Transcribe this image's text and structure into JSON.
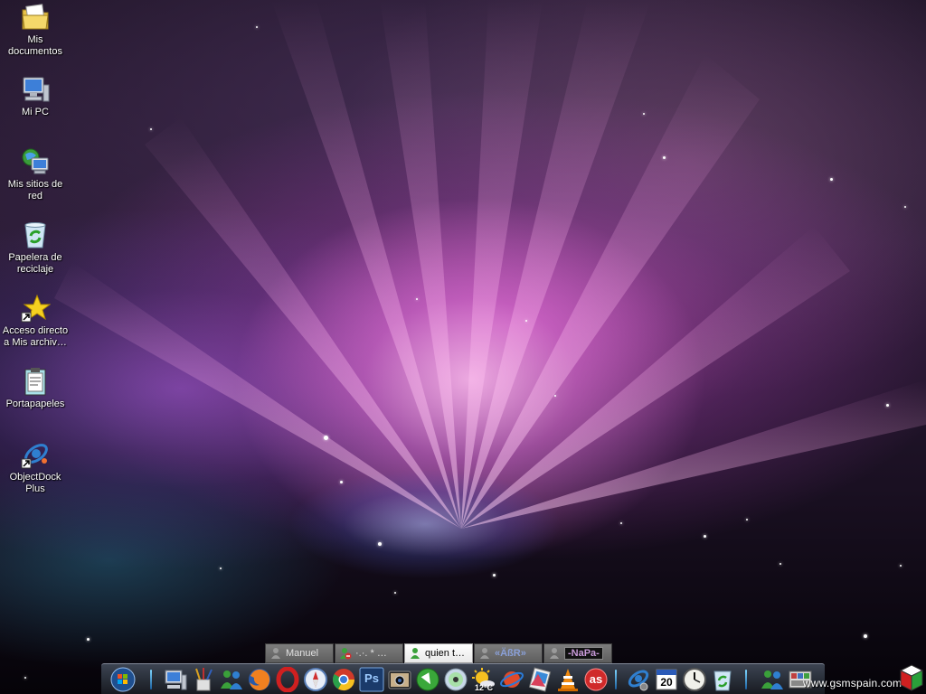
{
  "desktop": {
    "icons": [
      {
        "label": "Mis documentos",
        "icon": "folder-documents-icon"
      },
      {
        "label": "Mi PC",
        "icon": "computer-icon"
      },
      {
        "label": "Mis sitios de red",
        "icon": "network-places-icon"
      },
      {
        "label": "Papelera de reciclaje",
        "icon": "recycle-bin-icon"
      },
      {
        "label": "Acceso directo a Mis archiv…",
        "icon": "star-shortcut-icon"
      },
      {
        "label": "Portapapeles",
        "icon": "clipboard-icon"
      },
      {
        "label": "ObjectDock Plus",
        "icon": "objectdock-icon"
      }
    ]
  },
  "task_tabs": [
    {
      "label": "Manuel",
      "status": "offline"
    },
    {
      "label": "·.·. * …",
      "status": "busy"
    },
    {
      "label": "quien t…",
      "status": "online"
    },
    {
      "label": "«ÄßR»",
      "status": "offline"
    },
    {
      "label": "-NaPa-",
      "status": "offline"
    }
  ],
  "dock": {
    "items": [
      "windows-start-orb-icon",
      "my-computer-icon",
      "brushes-icon",
      "msn-messenger-icon",
      "firefox-icon",
      "opera-icon",
      "safari-icon",
      "chrome-icon",
      "photoshop-icon",
      "camera-icon",
      "download-icon",
      "cd-icon",
      "weather-icon",
      "orbit-icon",
      "pictures-icon",
      "vlc-icon",
      "lastfm-icon",
      "objectdock-settings-icon",
      "calendar-icon",
      "clock-icon",
      "recycle-bin-icon",
      "messenger-contacts-icon",
      "photo-gallery-icon"
    ],
    "weather_temp": "12°C",
    "calendar_day": "20",
    "photoshop_label": "Ps",
    "lastfm_label": "as"
  },
  "watermark": {
    "text": "www.gsmspain.com"
  }
}
